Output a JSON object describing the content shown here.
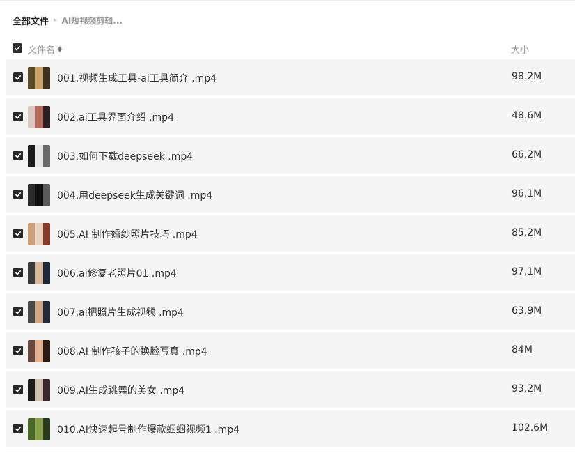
{
  "breadcrumb": {
    "root": "全部文件",
    "separator": "▸",
    "current": "AI短视频剪辑..."
  },
  "header": {
    "name_label": "文件名",
    "size_label": "大小",
    "select_all_checked": true
  },
  "files": [
    {
      "name": "001.视频生成工具-ai工具简介 .mp4",
      "size": "98.2M",
      "checked": true,
      "thumb": [
        "#5a4a2a",
        "#c9a36a",
        "#3d3020"
      ]
    },
    {
      "name": "002.ai工具界面介绍 .mp4",
      "size": "48.6M",
      "checked": true,
      "thumb": [
        "#d8c8c0",
        "#b36a5a",
        "#2a2020"
      ]
    },
    {
      "name": "003.如何下载deepseek .mp4",
      "size": "66.2M",
      "checked": true,
      "thumb": [
        "#1a1a1a",
        "#e8e8e8",
        "#6a6a6a"
      ]
    },
    {
      "name": "004.用deepseek生成关键词 .mp4",
      "size": "96.1M",
      "checked": true,
      "thumb": [
        "#2a2a2a",
        "#0e0e0e",
        "#5a5a5a"
      ]
    },
    {
      "name": "005.AI 制作婚纱照片技巧 .mp4",
      "size": "85.2M",
      "checked": true,
      "thumb": [
        "#c9a27a",
        "#e8d4c0",
        "#8a3a2a"
      ]
    },
    {
      "name": "006.ai修复老照片01 .mp4",
      "size": "97.1M",
      "checked": true,
      "thumb": [
        "#3a3a3a",
        "#d8b89a",
        "#1e2a3a"
      ]
    },
    {
      "name": "007.ai把照片生成视频 .mp4",
      "size": "63.9M",
      "checked": true,
      "thumb": [
        "#4a4a4a",
        "#cfa888",
        "#202a38"
      ]
    },
    {
      "name": "008.AI 制作孩子的换脸写真 .mp4",
      "size": "84M",
      "checked": true,
      "thumb": [
        "#6a4a3a",
        "#e0b090",
        "#2a1a14"
      ]
    },
    {
      "name": "009.AI生成跳舞的美女 .mp4",
      "size": "93.2M",
      "checked": true,
      "thumb": [
        "#1a1a1a",
        "#d0c0b0",
        "#3a2a2a"
      ]
    },
    {
      "name": "010.AI快速起号制作爆款蝈蝈视频1 .mp4",
      "size": "102.6M",
      "checked": true,
      "thumb": [
        "#4a6a2a",
        "#8aa04a",
        "#2a3a1a"
      ]
    }
  ],
  "colors": {
    "row_bg": "#f5f5f5",
    "checkbox": "#2b2b2b",
    "muted_text": "#999999"
  }
}
